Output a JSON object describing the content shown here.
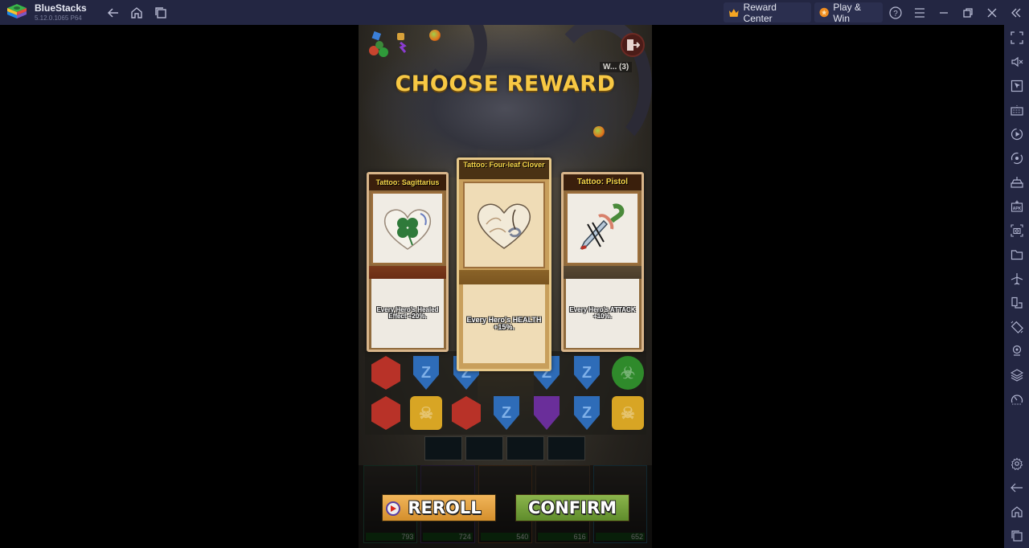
{
  "window": {
    "app_name": "BlueStacks",
    "version": "5.12.0.1065  P64",
    "nav": {
      "back_icon": "arrow-left-icon",
      "home_icon": "home-icon",
      "recents_icon": "recents-icon"
    },
    "reward_center_label": "Reward Center",
    "play_win_label": "Play & Win",
    "controls": [
      "help-icon",
      "menu-icon",
      "minimize-icon",
      "restore-icon",
      "close-icon",
      "collapse-sidebar-icon"
    ]
  },
  "sidebar": {
    "items": [
      {
        "name": "fullscreen",
        "icon": "fullscreen-icon"
      },
      {
        "name": "volume",
        "icon": "mute-icon"
      },
      {
        "name": "pointer",
        "icon": "pointer-icon"
      },
      {
        "name": "keyboard",
        "icon": "keyboard-icon"
      },
      {
        "name": "macro",
        "icon": "record-icon"
      },
      {
        "name": "sync",
        "icon": "rotate-icon"
      },
      {
        "name": "game-controls",
        "icon": "controls-icon"
      },
      {
        "name": "install-apk",
        "icon": "apk-icon"
      },
      {
        "name": "screenshot",
        "icon": "camera-icon"
      },
      {
        "name": "files",
        "icon": "folder-icon"
      },
      {
        "name": "airplane",
        "icon": "airplane-icon"
      },
      {
        "name": "multi-instance",
        "icon": "multi-instance-icon"
      },
      {
        "name": "rotate",
        "icon": "rotate-screen-icon"
      },
      {
        "name": "location",
        "icon": "location-icon"
      },
      {
        "name": "layers",
        "icon": "layers-icon"
      },
      {
        "name": "performance",
        "icon": "speedometer-icon"
      },
      {
        "name": "settings",
        "icon": "gear-icon"
      },
      {
        "name": "back",
        "icon": "arrow-left-icon"
      },
      {
        "name": "home",
        "icon": "home-icon"
      },
      {
        "name": "recents",
        "icon": "recents-icon"
      }
    ]
  },
  "game": {
    "title": "CHOOSE REWARD",
    "wave_label": "W... (3)",
    "cards": [
      {
        "title": "Tattoo: Sagittarius",
        "art": "clover-heart-tattoo",
        "description": "Every Hero's Healed Effect +20%."
      },
      {
        "title": "Tattoo: Four-leaf Clover",
        "art": "wave-heart-tattoo",
        "description": "Every Hero's HEALTH +15%.",
        "selected": true
      },
      {
        "title": "Tattoo: Pistol",
        "art": "dagger-tattoo",
        "description": "Every Hero's ATTACK +10%."
      }
    ],
    "board": {
      "rows": [
        [
          "red",
          "blue",
          "blue",
          "",
          "blue",
          "blue",
          "green"
        ],
        [
          "red",
          "yellow",
          "red",
          "blue",
          "purple",
          "blue",
          "yellow"
        ]
      ]
    },
    "heroes": [
      {
        "hp": "793"
      },
      {
        "hp": "724"
      },
      {
        "hp": "540"
      },
      {
        "hp": "616"
      },
      {
        "hp": "652"
      }
    ],
    "reroll_label": "REROLL",
    "confirm_label": "CONFIRM"
  }
}
